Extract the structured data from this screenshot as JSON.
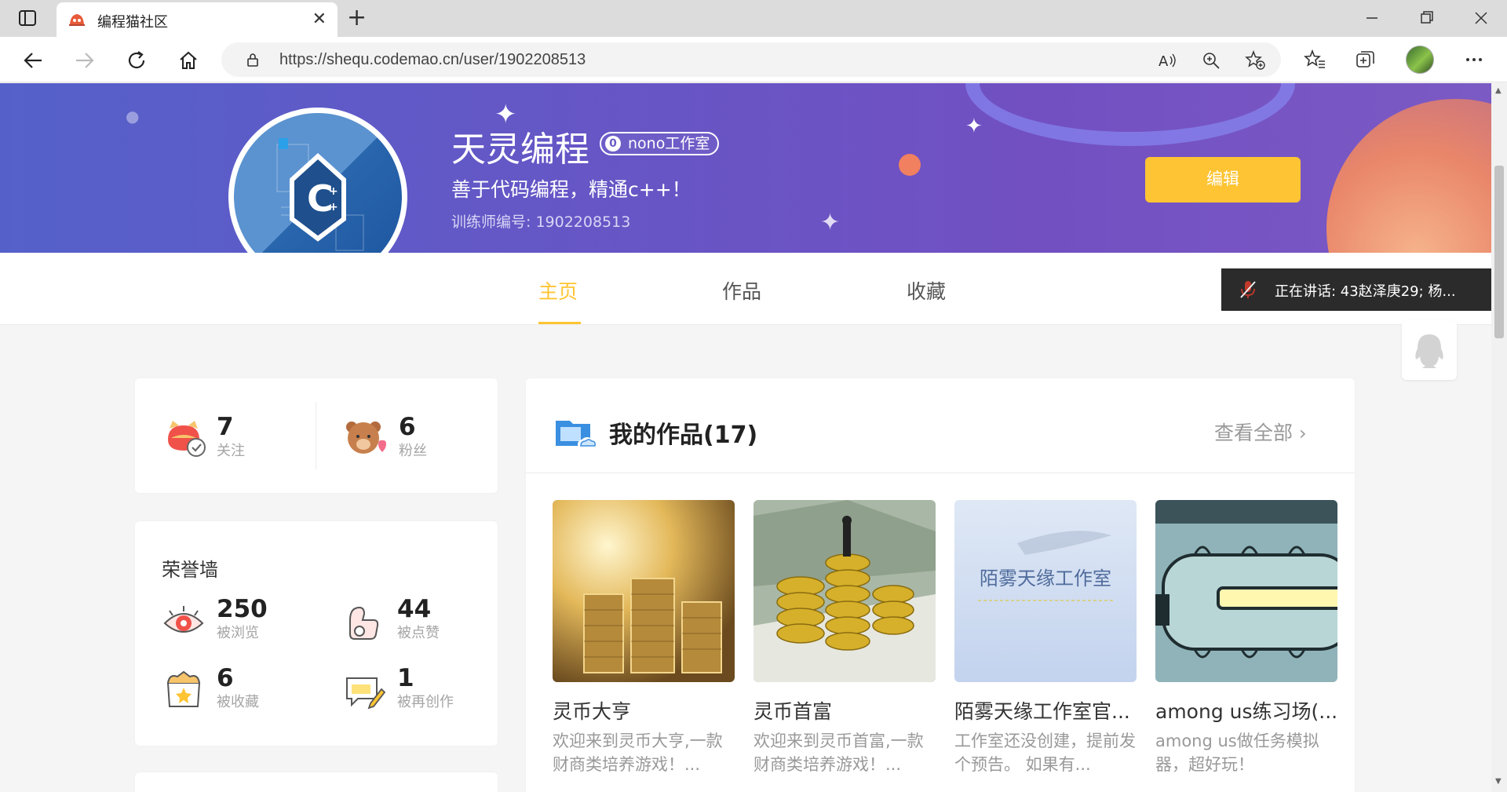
{
  "browser": {
    "tab_title": "编程猫社区",
    "url": "https://shequ.codemao.cn/user/1902208513"
  },
  "profile": {
    "name": "天灵编程",
    "studio_num": "0",
    "studio": "nono工作室",
    "bio": "善于代码编程，精通c++！",
    "trainer_id": "训练师编号: 1902208513",
    "edit_label": "编辑"
  },
  "tabs": [
    {
      "label": "主页",
      "active": true
    },
    {
      "label": "作品",
      "active": false
    },
    {
      "label": "收藏",
      "active": false
    }
  ],
  "speaking": "正在讲话: 43赵泽庚29; 杨...",
  "follow": {
    "following": {
      "count": "7",
      "label": "关注"
    },
    "fans": {
      "count": "6",
      "label": "粉丝"
    }
  },
  "honor": {
    "title": "荣誉墙",
    "items": [
      {
        "count": "250",
        "label": "被浏览",
        "icon": "eye-icon"
      },
      {
        "count": "44",
        "label": "被点赞",
        "icon": "thumbs-up-icon"
      },
      {
        "count": "6",
        "label": "被收藏",
        "icon": "star-box-icon"
      },
      {
        "count": "1",
        "label": "被再创作",
        "icon": "recreate-icon"
      }
    ]
  },
  "works": {
    "title": "我的作品(17)",
    "view_all": "查看全部",
    "items": [
      {
        "title": "灵币大亨",
        "desc": "欢迎来到灵币大亨,一款财商类培养游戏！..."
      },
      {
        "title": "灵币首富",
        "desc": "欢迎来到灵币首富,一款财商类培养游戏！..."
      },
      {
        "title": "陌雾天缘工作室官...",
        "desc": "工作室还没创建，提前发个预告。 如果有...",
        "thumb_text": "陌雾天缘工作室"
      },
      {
        "title": "among us练习场(...",
        "desc": "among us做任务模拟器，超好玩！"
      }
    ]
  },
  "colors": {
    "accent": "#fec433",
    "banner": "#6457c6"
  }
}
